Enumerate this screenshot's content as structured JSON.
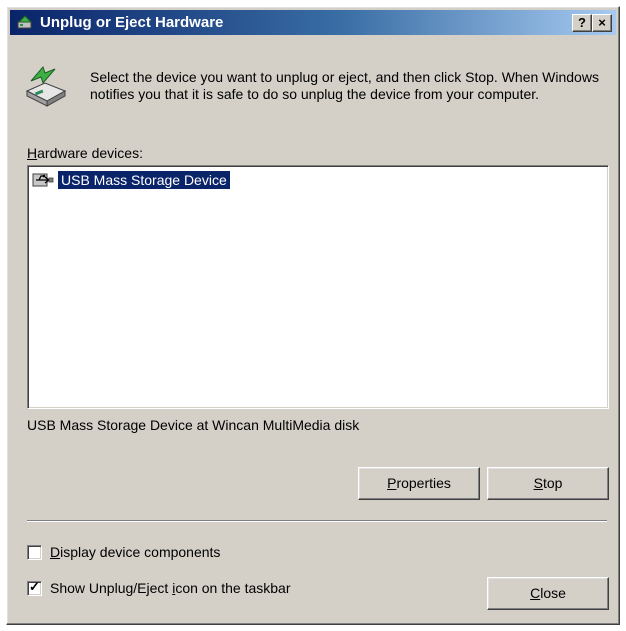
{
  "window": {
    "title": "Unplug or Eject Hardware",
    "help_button": "?",
    "close_button": "×"
  },
  "instructions": "Select the device you want to unplug or eject, and then click Stop. When Windows notifies you that it is safe to do so unplug the device from your computer.",
  "hardware_devices": {
    "label_accel": "H",
    "label_rest": "ardware devices:",
    "items": [
      {
        "label": "USB Mass Storage Device",
        "icon": "usb-device-icon",
        "selected": true
      }
    ]
  },
  "status_text": "USB Mass Storage Device at Wincan  MultiMedia disk",
  "buttons": {
    "properties_accel": "P",
    "properties_rest": "roperties",
    "stop_accel": "S",
    "stop_rest": "top",
    "close_accel": "C",
    "close_rest": "lose"
  },
  "options": {
    "display_components": {
      "accel": "D",
      "rest": "isplay device components",
      "checked": false
    },
    "show_icon": {
      "before": "Show Unplug/Eject ",
      "accel": "i",
      "after": "con on the taskbar",
      "checked": true
    }
  },
  "colors": {
    "selection": "#0a246a",
    "dialog_bg": "#d4d0c8",
    "title_start": "#0a246a",
    "title_end": "#a6caf0"
  }
}
